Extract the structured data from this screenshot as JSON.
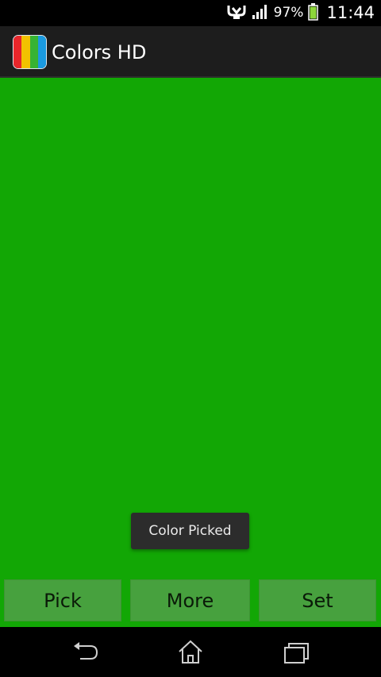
{
  "status_bar": {
    "battery_percent": "97%",
    "time": "11:44",
    "icons": [
      "nfc-icon",
      "signal-icon",
      "battery-icon"
    ]
  },
  "action_bar": {
    "app_title": "Colors HD",
    "app_icon": "colors-hd-app-icon",
    "icon_stripes": [
      "#e8262b",
      "#f2c200",
      "#37b332",
      "#1a9ae0"
    ]
  },
  "preview": {
    "color": "#12a705"
  },
  "toast": {
    "message": "Color Picked"
  },
  "buttons": {
    "pick": "Pick",
    "more": "More",
    "set": "Set"
  },
  "nav_bar": {
    "icons": [
      "back-icon",
      "home-icon",
      "recents-icon"
    ]
  }
}
